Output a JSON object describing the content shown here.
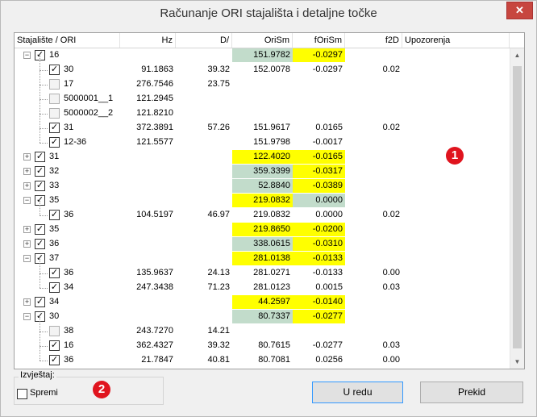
{
  "window": {
    "title": "Računanje ORI stajališta i detaljne točke",
    "close_label": "✕"
  },
  "table": {
    "columns": [
      "Stajalište / ORI",
      "Hz",
      "D/",
      "OriSm",
      "fOriSm",
      "f2D",
      "Upozorenja"
    ],
    "rows": [
      {
        "level": 0,
        "expander": "−",
        "checked": true,
        "name": "16",
        "hz": "",
        "d": "",
        "orism": "151.9782",
        "forism": "-0.0297",
        "f2d": "",
        "oriHl": "green",
        "fHl": "yellow"
      },
      {
        "level": 1,
        "checked": true,
        "name": "30",
        "hz": "91.1863",
        "d": "39.32",
        "orism": "152.0078",
        "forism": "-0.0297",
        "f2d": "0.02",
        "oriHl": "",
        "fHl": ""
      },
      {
        "level": 1,
        "checked": false,
        "name": "17",
        "hz": "276.7546",
        "d": "23.75",
        "orism": "",
        "forism": "",
        "f2d": "",
        "oriHl": "",
        "fHl": ""
      },
      {
        "level": 1,
        "checked": false,
        "name": "5000001__1",
        "hz": "121.2945",
        "d": "",
        "orism": "",
        "forism": "",
        "f2d": "",
        "oriHl": "",
        "fHl": ""
      },
      {
        "level": 1,
        "checked": false,
        "name": "5000002__2",
        "hz": "121.8210",
        "d": "",
        "orism": "",
        "forism": "",
        "f2d": "",
        "oriHl": "",
        "fHl": ""
      },
      {
        "level": 1,
        "checked": true,
        "name": "31",
        "hz": "372.3891",
        "d": "57.26",
        "orism": "151.9617",
        "forism": "0.0165",
        "f2d": "0.02",
        "oriHl": "",
        "fHl": ""
      },
      {
        "level": 1,
        "checked": true,
        "name": "12-36",
        "hz": "121.5577",
        "d": "",
        "orism": "151.9798",
        "forism": "-0.0017",
        "f2d": "",
        "oriHl": "",
        "fHl": "",
        "last": true
      },
      {
        "level": 0,
        "expander": "+",
        "checked": true,
        "name": "31",
        "hz": "",
        "d": "",
        "orism": "122.4020",
        "forism": "-0.0165",
        "f2d": "",
        "oriHl": "yellow",
        "fHl": "yellow"
      },
      {
        "level": 0,
        "expander": "+",
        "checked": true,
        "name": "32",
        "hz": "",
        "d": "",
        "orism": "359.3399",
        "forism": "-0.0317",
        "f2d": "",
        "oriHl": "green",
        "fHl": "yellow"
      },
      {
        "level": 0,
        "expander": "+",
        "checked": true,
        "name": "33",
        "hz": "",
        "d": "",
        "orism": "52.8840",
        "forism": "-0.0389",
        "f2d": "",
        "oriHl": "green",
        "fHl": "yellow"
      },
      {
        "level": 0,
        "expander": "−",
        "checked": true,
        "name": "35",
        "hz": "",
        "d": "",
        "orism": "219.0832",
        "forism": "0.0000",
        "f2d": "",
        "oriHl": "yellow",
        "fHl": "green"
      },
      {
        "level": 1,
        "checked": true,
        "name": "36",
        "hz": "104.5197",
        "d": "46.97",
        "orism": "219.0832",
        "forism": "0.0000",
        "f2d": "0.02",
        "oriHl": "",
        "fHl": "",
        "last": true
      },
      {
        "level": 0,
        "expander": "+",
        "checked": true,
        "name": "35",
        "hz": "",
        "d": "",
        "orism": "219.8650",
        "forism": "-0.0200",
        "f2d": "",
        "oriHl": "yellow",
        "fHl": "yellow"
      },
      {
        "level": 0,
        "expander": "+",
        "checked": true,
        "name": "36",
        "hz": "",
        "d": "",
        "orism": "338.0615",
        "forism": "-0.0310",
        "f2d": "",
        "oriHl": "green",
        "fHl": "yellow"
      },
      {
        "level": 0,
        "expander": "−",
        "checked": true,
        "name": "37",
        "hz": "",
        "d": "",
        "orism": "281.0138",
        "forism": "-0.0133",
        "f2d": "",
        "oriHl": "yellow",
        "fHl": "yellow"
      },
      {
        "level": 1,
        "checked": true,
        "name": "36",
        "hz": "135.9637",
        "d": "24.13",
        "orism": "281.0271",
        "forism": "-0.0133",
        "f2d": "0.00",
        "oriHl": "",
        "fHl": ""
      },
      {
        "level": 1,
        "checked": true,
        "name": "34",
        "hz": "247.3438",
        "d": "71.23",
        "orism": "281.0123",
        "forism": "0.0015",
        "f2d": "0.03",
        "oriHl": "",
        "fHl": "",
        "last": true
      },
      {
        "level": 0,
        "expander": "+",
        "checked": true,
        "name": "34",
        "hz": "",
        "d": "",
        "orism": "44.2597",
        "forism": "-0.0140",
        "f2d": "",
        "oriHl": "yellow",
        "fHl": "yellow"
      },
      {
        "level": 0,
        "expander": "−",
        "checked": true,
        "name": "30",
        "hz": "",
        "d": "",
        "orism": "80.7337",
        "forism": "-0.0277",
        "f2d": "",
        "oriHl": "green",
        "fHl": "yellow"
      },
      {
        "level": 1,
        "checked": false,
        "name": "38",
        "hz": "243.7270",
        "d": "14.21",
        "orism": "",
        "forism": "",
        "f2d": "",
        "oriHl": "",
        "fHl": ""
      },
      {
        "level": 1,
        "checked": true,
        "name": "16",
        "hz": "362.4327",
        "d": "39.32",
        "orism": "80.7615",
        "forism": "-0.0277",
        "f2d": "0.03",
        "oriHl": "",
        "fHl": ""
      },
      {
        "level": 1,
        "checked": true,
        "name": "36",
        "hz": "21.7847",
        "d": "40.81",
        "orism": "80.7081",
        "forism": "0.0256",
        "f2d": "0.00",
        "oriHl": "",
        "fHl": "",
        "last": true
      }
    ]
  },
  "report": {
    "group_label": "Izvještaj:",
    "save_label": "Spremi"
  },
  "buttons": {
    "ok": "U redu",
    "cancel": "Prekid"
  },
  "badges": [
    "1",
    "2"
  ],
  "colors": {
    "highlight_yellow": "#ffff00",
    "highlight_green": "#c2dccb",
    "badge_red": "#e0141e"
  }
}
